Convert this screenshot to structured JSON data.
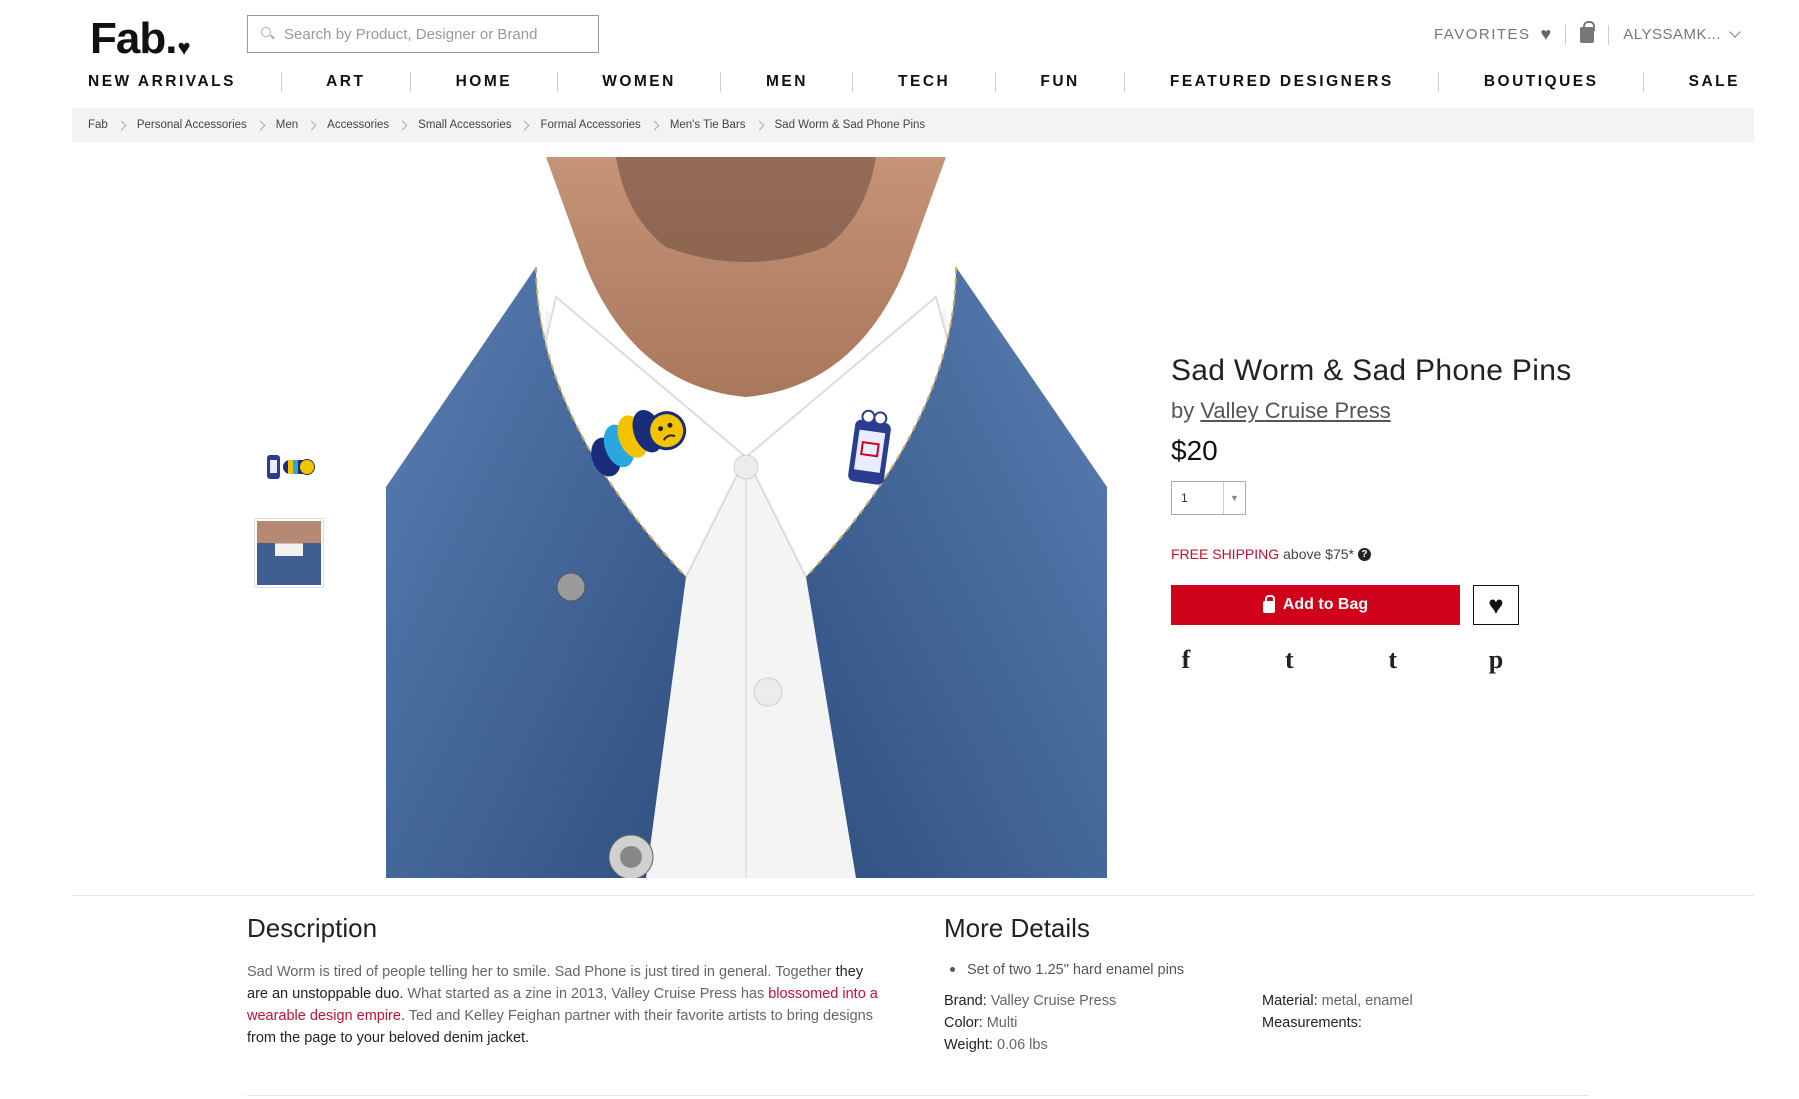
{
  "header": {
    "logo_text": "Fab",
    "search_placeholder": "Search by Product, Designer or Brand",
    "favorites_label": "FAVORITES",
    "user_label": "ALYSSAMK..."
  },
  "nav": {
    "items": [
      "NEW ARRIVALS",
      "ART",
      "HOME",
      "WOMEN",
      "MEN",
      "TECH",
      "FUN",
      "FEATURED DESIGNERS",
      "BOUTIQUES",
      "SALE"
    ]
  },
  "breadcrumb": [
    "Fab",
    "Personal Accessories",
    "Men",
    "Accessories",
    "Small Accessories",
    "Formal Accessories",
    "Men's Tie Bars",
    "Sad Worm & Sad Phone Pins"
  ],
  "product": {
    "title": "Sad Worm & Sad Phone Pins",
    "by_prefix": "by",
    "brand": "Valley Cruise Press",
    "price": "$20",
    "quantity": "1",
    "shipping_highlight": "FREE SHIPPING",
    "shipping_rest": "above $75*",
    "add_to_bag": "Add to Bag"
  },
  "social": [
    "f",
    "t",
    "t",
    "p"
  ],
  "description": {
    "heading": "Description",
    "p1": "Sad Worm is tired of people telling her to smile. Sad Phone is just tired in general. Together",
    "p2": "they are an unstoppable duo.",
    "p3": " What started as a zine in 2013, Valley Cruise Press has ",
    "p4": "blossomed into a wearable design empire.",
    "p5": " Ted and Kelley Feighan partner with their favorite artists to bring designs",
    "p6": " from the page to your beloved denim jacket."
  },
  "details": {
    "heading": "More Details",
    "bullet": "Set of two 1.25\" hard enamel pins",
    "brand_label": "Brand:",
    "brand_value": "Valley Cruise Press",
    "color_label": "Color:",
    "color_value": "Multi",
    "weight_label": "Weight:",
    "weight_value": "0.06 lbs",
    "material_label": "Material:",
    "material_value": "metal, enamel",
    "measurements_label": "Measurements:"
  },
  "colors": {
    "accent_red": "#d0021b",
    "breadcrumb_bg": "#f3f3f3"
  }
}
